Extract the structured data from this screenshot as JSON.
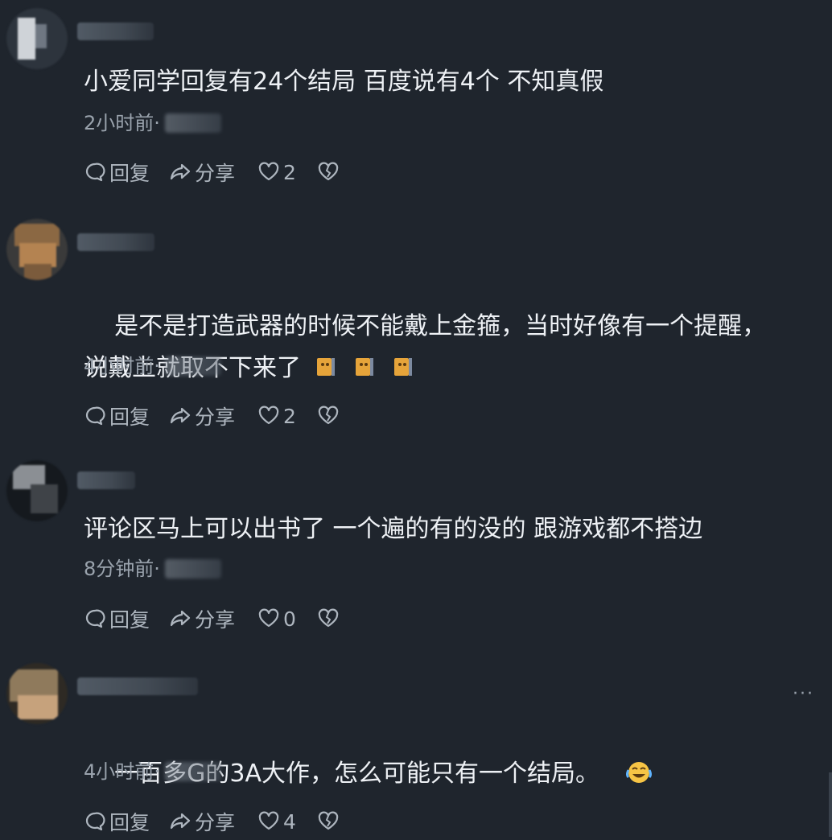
{
  "comments": [
    {
      "text": "小爱同学回复有24个结局 百度说有4个 不知真假",
      "time": "2小时前·",
      "reply_label": "回复",
      "share_label": "分享",
      "likes": "2"
    },
    {
      "text": "是不是打造武器的时候不能戴上金箍，当时好像有一个提醒，\n说戴上就取不下来了",
      "time": "4小时前·",
      "reply_label": "回复",
      "share_label": "分享",
      "likes": "2",
      "emojis": [
        "monkey-emoji",
        "monkey-emoji",
        "monkey-emoji"
      ]
    },
    {
      "text": "评论区马上可以出书了 一个遍的有的没的 跟游戏都不搭边",
      "time": "8分钟前·",
      "reply_label": "回复",
      "share_label": "分享",
      "likes": "0"
    },
    {
      "text": "一百多G的3A大作，怎么可能只有一个结局。",
      "time": "4小时前·",
      "reply_label": "回复",
      "share_label": "分享",
      "likes": "4",
      "emojis": [
        "laughing-tears-emoji"
      ],
      "more_label": "···"
    }
  ],
  "colors": {
    "background": "#1f252d",
    "text": "#eef1f5",
    "meta": "#9aa3ad",
    "action": "#aeb6bf"
  }
}
